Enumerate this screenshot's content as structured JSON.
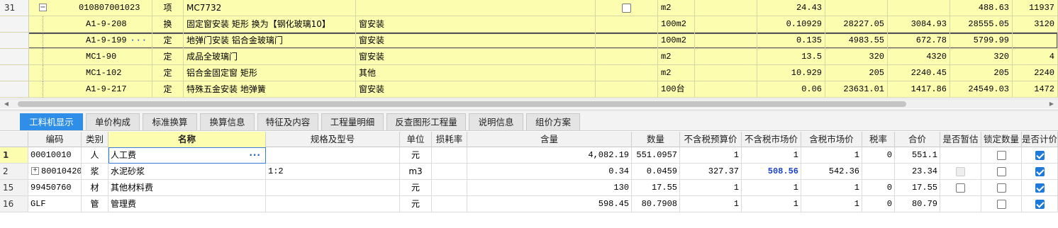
{
  "top_rows": [
    {
      "num": "31",
      "code": "010807001023",
      "type": "项",
      "name": "MC7732",
      "spec": "",
      "unit": "m2",
      "qty": "24.43",
      "price": "",
      "sum": "",
      "v1": "488.63",
      "v2": "11937",
      "hasMinus": true,
      "hasCheckbox": true
    },
    {
      "num": "",
      "code": "A1-9-208",
      "type": "换",
      "name": "固定窗安装 矩形  换为【钢化玻璃10】",
      "spec": "窗安装",
      "unit": "100m2",
      "qty": "0.10929",
      "price": "28227.05",
      "sum": "3084.93",
      "v1": "28555.05",
      "v2": "3120"
    },
    {
      "num": "",
      "code": "A1-9-199",
      "type": "定",
      "name": "地弹门安装 铝合金玻璃门",
      "spec": "窗安装",
      "unit": "100m2",
      "qty": "0.135",
      "price": "4983.55",
      "sum": "672.78",
      "v1": "5799.99",
      "v2": "",
      "selected": true,
      "dots": "···"
    },
    {
      "num": "",
      "code": "MC1-90",
      "type": "定",
      "name": "成品全玻璃门",
      "spec": "窗安装",
      "unit": "m2",
      "qty": "13.5",
      "price": "320",
      "sum": "4320",
      "v1": "320",
      "v2": "4"
    },
    {
      "num": "",
      "code": "MC1-102",
      "type": "定",
      "name": "铝合金固定窗 矩形",
      "spec": "其他",
      "unit": "m2",
      "qty": "10.929",
      "price": "205",
      "sum": "2240.45",
      "v1": "205",
      "v2": "2240"
    },
    {
      "num": "",
      "code": "A1-9-217",
      "type": "定",
      "name": "特殊五金安装 地弹簧",
      "spec": "窗安装",
      "unit": "100台",
      "qty": "0.06",
      "price": "23631.01",
      "sum": "1417.86",
      "v1": "24549.03",
      "v2": "1472"
    }
  ],
  "tabs": [
    "工料机显示",
    "单价构成",
    "标准换算",
    "换算信息",
    "特征及内容",
    "工程量明细",
    "反查图形工程量",
    "说明信息",
    "组价方案"
  ],
  "active_tab": 0,
  "columns": [
    "编码",
    "类别",
    "名称",
    "规格及型号",
    "单位",
    "损耗率",
    "含量",
    "数量",
    "不含税预算价",
    "不含税市场价",
    "含税市场价",
    "税率",
    "合价",
    "是否暂估",
    "锁定数量",
    "是否计价"
  ],
  "rows": [
    {
      "rn": "1",
      "code": "00010010",
      "cat": "人",
      "name": "人工费",
      "spec": "",
      "unit": "元",
      "loss": "",
      "content": "4,082.19",
      "qty": "551.0957",
      "budget": "1",
      "market": "1",
      "taxmarket": "1",
      "rate": "0",
      "total": "551.1",
      "est": "none",
      "lock": "off",
      "priced": "on",
      "dots": "···",
      "active": true
    },
    {
      "rn": "2",
      "code": "80010420",
      "cat": "浆",
      "name": "水泥砂浆",
      "spec": "1:2",
      "unit": "m3",
      "loss": "",
      "content": "0.34",
      "qty": "0.0459",
      "budget": "327.37",
      "market": "508.56",
      "taxmarket": "542.36",
      "rate": "",
      "total": "23.34",
      "est": "dis",
      "lock": "off",
      "priced": "on",
      "plus": "+"
    },
    {
      "rn": "15",
      "code": "99450760",
      "cat": "材",
      "name": "其他材料费",
      "spec": "",
      "unit": "元",
      "loss": "",
      "content": "130",
      "qty": "17.55",
      "budget": "1",
      "market": "1",
      "taxmarket": "1",
      "rate": "0",
      "total": "17.55",
      "est": "off",
      "lock": "off",
      "priced": "on"
    },
    {
      "rn": "16",
      "code": "GLF",
      "cat": "管",
      "name": "管理费",
      "spec": "",
      "unit": "元",
      "loss": "",
      "content": "598.45",
      "qty": "80.7908",
      "budget": "1",
      "market": "1",
      "taxmarket": "1",
      "rate": "0",
      "total": "80.79",
      "est": "none",
      "lock": "off",
      "priced": "on"
    }
  ],
  "colors": {
    "row_yellow": "#fdfdb0",
    "tab_active": "#2f8ee8",
    "market_blue": "#1a3fc8"
  }
}
